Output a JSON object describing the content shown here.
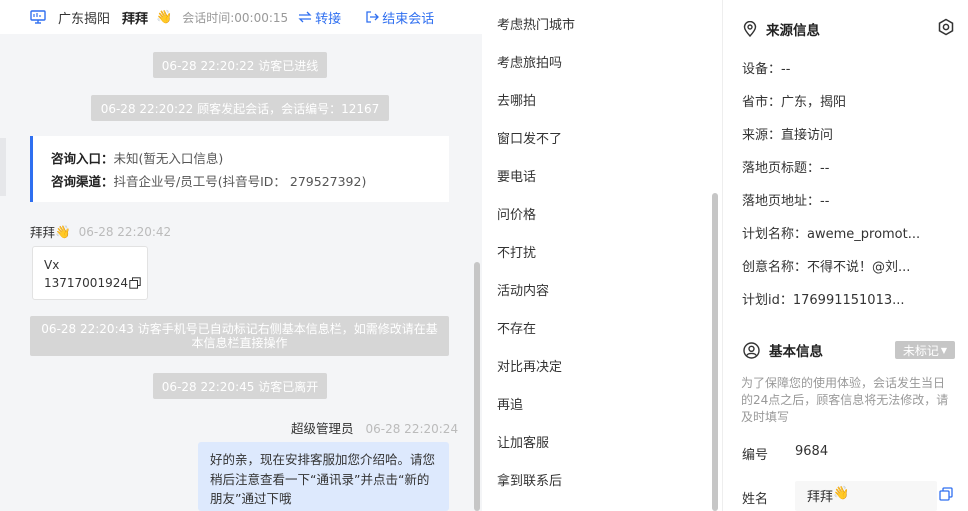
{
  "header": {
    "location": "广东揭阳",
    "visitor_name": "拜拜",
    "session_label": "会话时间:",
    "session_time": "00:00:15",
    "transfer_label": "转接",
    "end_label": "结束会话"
  },
  "messages": {
    "sys_entered": "06-28 22:20:22 访客已进线",
    "sys_started": "06-28 22:20:22 顾客发起会话，会话编号：12167",
    "info": {
      "entry_label": "咨询入口：",
      "entry_value": "未知(暂无入口信息)",
      "channel_label": "咨询渠道：",
      "channel_value": "抖音企业号/员工号(抖音号ID： 279527392)"
    },
    "visitor_name": "拜拜",
    "visitor_time": "06-28 22:20:42",
    "visitor_msg_line1": "Vx",
    "visitor_msg_line2": "13717001924",
    "sys_phone": "06-28 22:20:43 访客手机号已自动标记右侧基本信息栏，如需修改请在基本信息栏直接操作",
    "sys_left": "06-28 22:20:45 访客已离开",
    "agent_name": "超级管理员",
    "agent_time": "06-28 22:20:24",
    "agent_msg": "好的亲，现在安排客服加您介绍哈。请您稍后注意查看一下“通讯录”并点击“新的朋友”通过下哦"
  },
  "quick_tags": [
    "考虑热门城市",
    "考虑旅拍吗",
    "去哪拍",
    "窗口发不了",
    "要电话",
    "问价格",
    "不打扰",
    "活动内容",
    "不存在",
    "对比再决定",
    "再追",
    "让加客服",
    "拿到联系后"
  ],
  "source_info": {
    "title": "来源信息",
    "device": "设备：--",
    "province": "省市：广东，揭阳",
    "source": "来源：直接访问",
    "landing_title": "落地页标题：--",
    "landing_url": "落地页地址：--",
    "plan_name": "计划名称：aweme_promot...",
    "creative_name": "创意名称：不得不说！@刘...",
    "plan_id": "计划id：176991151013..."
  },
  "basic_info": {
    "title": "基本信息",
    "status": "未标记",
    "note": "为了保障您的使用体验，会话发生当日的24点之后，顾客信息将无法修改，请及时填写",
    "id_label": "编号",
    "id_value": "9684",
    "name_label": "姓名",
    "name_value": "拜拜"
  },
  "colors": {
    "accent": "#2f6ff0",
    "system_bubble": "#d6d6d6",
    "agent_bubble": "#dde9fd"
  }
}
